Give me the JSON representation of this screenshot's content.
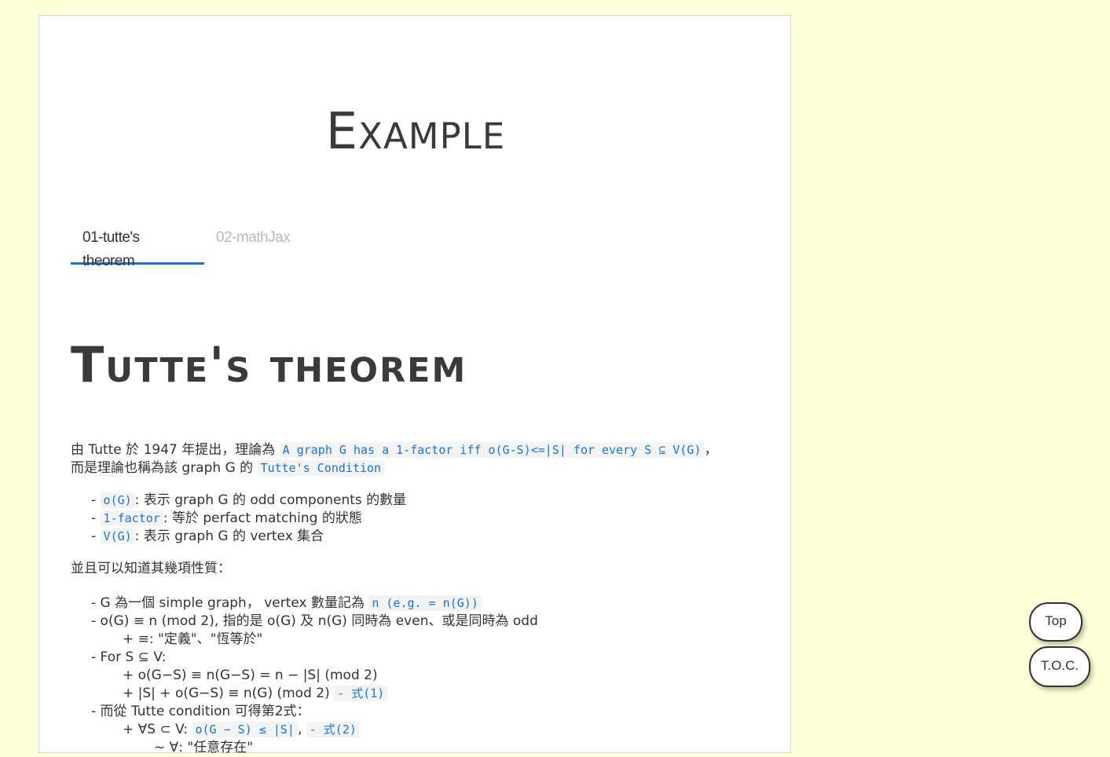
{
  "page": {
    "title": "Example"
  },
  "tabs": [
    {
      "label": "01-tutte's theorem",
      "active": true
    },
    {
      "label": "02-mathJax",
      "active": false
    }
  ],
  "article": {
    "heading": "Tutte's theorem",
    "intro_prefix": "由 Tutte 於 1947 年提出，理論為 ",
    "intro_code": "A graph G has a 1-factor iff o(G-S)<=|S| for every S ⊆ V(G)",
    "intro_mid": "，",
    "intro_line2": "而是理論也稱為該 graph G 的 ",
    "intro_code2": "Tutte's Condition",
    "defs": [
      {
        "code": "o(G)",
        "text": ": 表示 graph G 的 odd components 的數量"
      },
      {
        "code": "1-factor",
        "text": ": 等於 perfact matching 的狀態"
      },
      {
        "code": "V(G)",
        "text": ": 表示 graph G 的 vertex 集合"
      }
    ],
    "properties_intro": "並且可以知道其幾項性質：",
    "props": {
      "p1_text": "- G 為一個 simple graph， vertex 數量記為 ",
      "p1_code": "n (e.g. = n(G))",
      "p2_text": "- o(G) ≡ n (mod 2), 指的是 o(G) 及 n(G) 同時為 even、或是同時為 odd",
      "p2_sub": "+ ≡: \"定義\"、\"恆等於\"",
      "p3_text": "- For S ⊆ V:",
      "p3_sub1": "+ o(G−S) ≡ n(G−S) = n − |S| (mod 2)",
      "p3_sub2_text": "+ |S| + o(G−S) ≡ n(G) (mod 2) ",
      "p3_sub2_code": "- 式(1)",
      "p4_text": "- 而從 Tutte condition 可得第2式：",
      "p4_sub_text": "+ ∀S ⊂ V: ",
      "p4_sub_code": "o(G − S) ≤ |S|",
      "p4_sub_sep": ", ",
      "p4_sub_code2": "- 式(2)",
      "p4_sub2": "~ ∀: \"任意存在\""
    }
  },
  "buttons": {
    "top": "Top",
    "toc": "T.O.C."
  }
}
